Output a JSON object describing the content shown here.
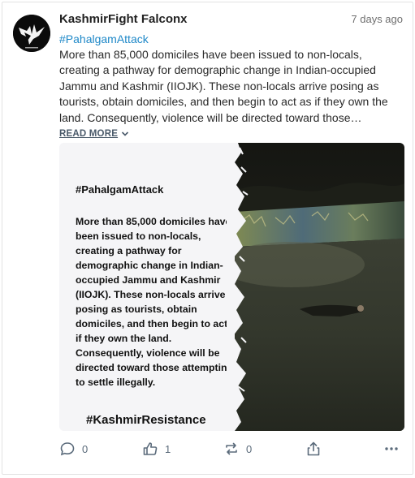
{
  "post": {
    "author": "KashmirFight Falconx",
    "time": "7 days ago",
    "hashtag": "#PahalgamAttack",
    "text": "More than 85,000 domiciles have been issued to non-locals, creating a pathway for demographic change in Indian-occupied Jammu and Kashmir (IIOJK). These non-locals arrive posing as tourists, obtain domiciles, and then begin to act as if they own the land. Consequently, violence will be directed toward those…",
    "read_more": "READ MORE"
  },
  "media": {
    "hashtag": "#PahalgamAttack",
    "body": "More than 85,000 domiciles have been issued to non-locals, creating a pathway for demographic change in Indian-occupied Jammu and Kashmir (IIOJK). These non-locals arrive posing as tourists, obtain domiciles, and then begin to act as if they own the land. Consequently, violence will be directed toward those attempting to settle illegally.",
    "footer": "#KashmirResistance"
  },
  "actions": {
    "comments": "0",
    "likes": "1",
    "reposts": "0"
  },
  "icons": [
    "comment-icon",
    "thumbs-up-icon",
    "repost-icon",
    "share-icon",
    "more-icon",
    "chevron-down-icon"
  ],
  "colors": {
    "hashtag": "#1e88c8",
    "icon": "#5b6b7b"
  }
}
